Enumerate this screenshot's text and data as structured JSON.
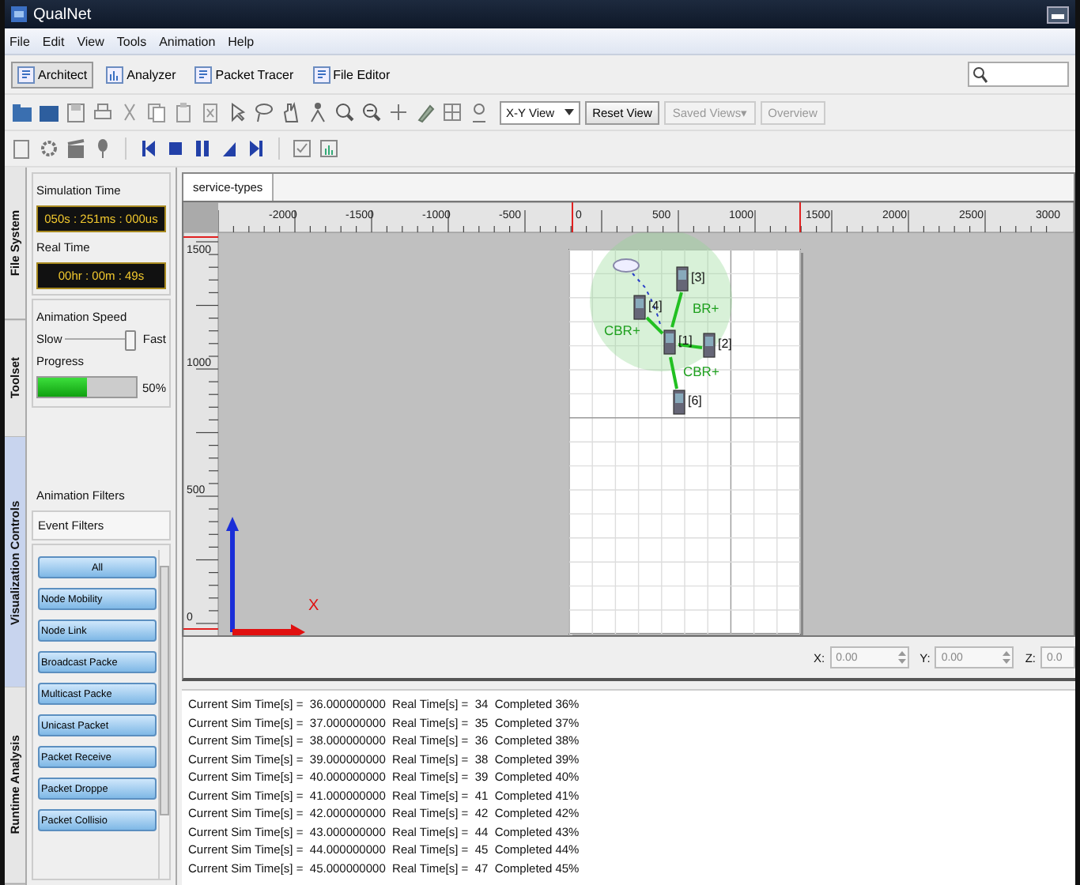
{
  "window": {
    "title": "QualNet"
  },
  "menu": [
    "File",
    "Edit",
    "View",
    "Tools",
    "Animation",
    "Help"
  ],
  "modes": [
    {
      "label": "Architect",
      "selected": true
    },
    {
      "label": "Analyzer",
      "selected": false
    },
    {
      "label": "Packet Tracer",
      "selected": false
    },
    {
      "label": "File Editor",
      "selected": false
    }
  ],
  "view_toolbar": {
    "view_select": "X-Y View",
    "buttons": [
      {
        "label": "Reset View",
        "disabled": false
      },
      {
        "label": "Saved Views▾",
        "disabled": true
      },
      {
        "label": "Overview",
        "disabled": true
      }
    ]
  },
  "side_tabs": [
    {
      "label": "File System",
      "selected": false
    },
    {
      "label": "Toolset",
      "selected": false
    },
    {
      "label": "Visualization Controls",
      "selected": true
    },
    {
      "label": "Runtime Analysis",
      "selected": false
    }
  ],
  "controls": {
    "simulation_time_label": "Simulation Time",
    "simulation_time": "050s : 251ms : 000us",
    "real_time_label": "Real Time",
    "real_time": "00hr : 00m : 49s",
    "speed_label": "Animation Speed",
    "speed_min": "Slow",
    "speed_max": "Fast",
    "speed": {
      "level": 0.95
    },
    "progress_label": "Progress",
    "progress": {
      "level": 0.5
    },
    "progress_reading": "50%"
  },
  "filters": {
    "title": "Animation Filters",
    "tab": "Event Filters",
    "items": [
      "All",
      "Node Mobility",
      "Node Link",
      "Broadcast Packe",
      "Multicast Packe",
      "Unicast Packet",
      "Packet Receive",
      "Packet Droppe",
      "Packet Collisio"
    ]
  },
  "editor": {
    "tabs": [
      {
        "label": "service-types",
        "selected": true
      }
    ],
    "ruler": {
      "x_labels": [
        "-2000",
        "-1500",
        "-1000",
        "-500",
        "0",
        "500",
        "1000",
        "1500",
        "2000",
        "2500",
        "3000"
      ],
      "y_labels": [
        "1500",
        "1000",
        "500",
        "0"
      ]
    },
    "nodes": [
      {
        "label": "[3]"
      },
      {
        "label": "[4]"
      },
      {
        "label": "[1]"
      },
      {
        "label": "[2]"
      },
      {
        "label": "[6]"
      }
    ],
    "link_labels": [
      "BR+",
      "CBR+",
      "CBR+"
    ],
    "axis_label": "X",
    "coords": [
      {
        "label": "X:",
        "value": "0.00"
      },
      {
        "label": "Y:",
        "value": "0.00"
      },
      {
        "label": "Z:",
        "value": "0.0"
      }
    ]
  },
  "log": [
    "Current Sim Time[s] =  36.000000000  Real Time[s] =  34  Completed 36%",
    "Current Sim Time[s] =  37.000000000  Real Time[s] =  35  Completed 37%",
    "Current Sim Time[s] =  38.000000000  Real Time[s] =  36  Completed 38%",
    "Current Sim Time[s] =  39.000000000  Real Time[s] =  38  Completed 39%",
    "Current Sim Time[s] =  40.000000000  Real Time[s] =  39  Completed 40%",
    "Current Sim Time[s] =  41.000000000  Real Time[s] =  41  Completed 41%",
    "Current Sim Time[s] =  42.000000000  Real Time[s] =  42  Completed 42%",
    "Current Sim Time[s] =  43.000000000  Real Time[s] =  44  Completed 43%",
    "Current Sim Time[s] =  44.000000000  Real Time[s] =  45  Completed 44%",
    "Current Sim Time[s] =  45.000000000  Real Time[s] =  47  Completed 45%"
  ]
}
